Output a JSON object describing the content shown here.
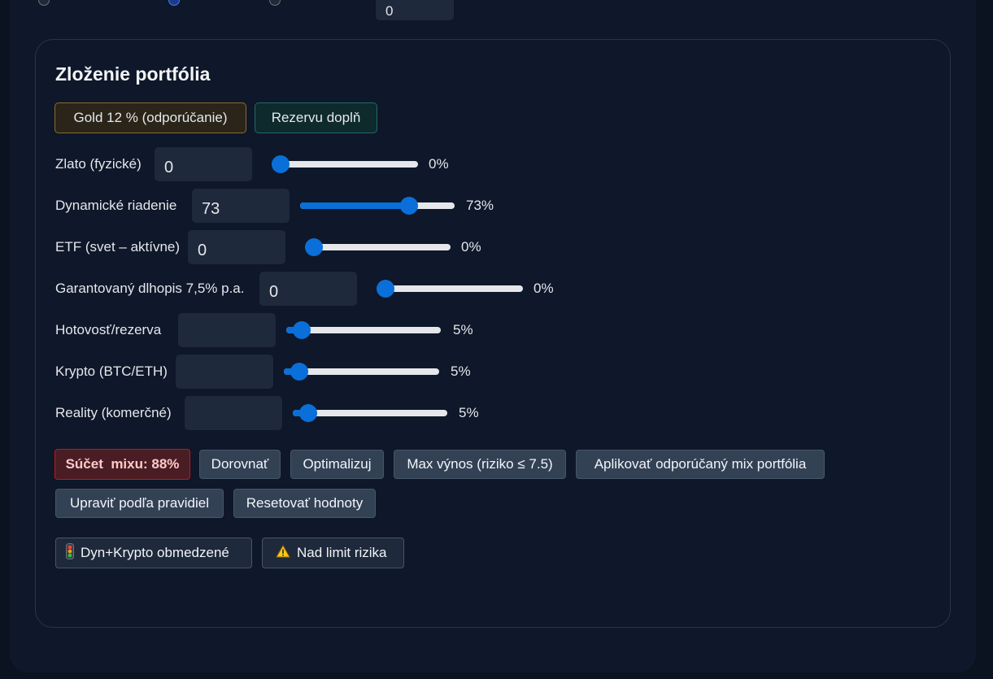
{
  "top": {
    "value": "0"
  },
  "portfolio": {
    "title": "Zloženie portfólia",
    "chips": {
      "gold": "Gold 12 % (odporúčanie)",
      "reserve": "Rezervu doplň"
    },
    "rows": [
      {
        "label": "Zlato (fyzické)",
        "input": "0",
        "value": 0,
        "pct": "0%"
      },
      {
        "label": "Dynamické riadenie",
        "input": "73",
        "value": 73,
        "pct": "73%"
      },
      {
        "label": "ETF (svet – aktívne)",
        "input": "0",
        "value": 0,
        "pct": "0%"
      },
      {
        "label": "Garantovaný dlhopis 7,5% p.a.",
        "input": "0",
        "value": 0,
        "pct": "0%"
      },
      {
        "label": "Hotovosť/rezerva",
        "input": "",
        "value": 5,
        "pct": "5%"
      },
      {
        "label": "Krypto (BTC/ETH)",
        "input": "",
        "value": 5,
        "pct": "5%"
      },
      {
        "label": "Reality (komerčné)",
        "input": "",
        "value": 5,
        "pct": "5%"
      }
    ],
    "sum_text": "Súčet  mixu: 88%",
    "buttons": {
      "equalize": "Dorovnať",
      "optimize": "Optimalizuj",
      "max_yield": "Max výnos (riziko ≤ 7.5)",
      "apply_mix": "Aplikovať odporúčaný mix portfólia",
      "rules": "Upraviť podľa pravidiel",
      "reset": "Resetovať hodnoty"
    },
    "status": {
      "dyn_crypto": "Dyn+Krypto obmedzené",
      "dyn_crypto_icon": "traffic-light-icon",
      "risk": "Nad limit rizika",
      "risk_icon": "warning-icon"
    },
    "colors": {
      "accent": "#0a6fd8",
      "sum_bg": "#4a1d24",
      "sum_border": "#b91c1c"
    }
  }
}
